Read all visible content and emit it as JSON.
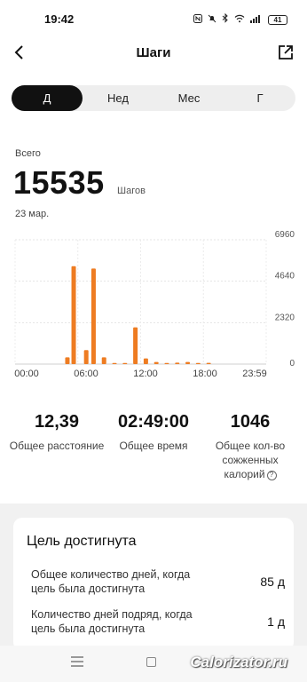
{
  "status_bar": {
    "time": "19:42",
    "battery": "41",
    "icons": [
      "nfc-icon",
      "mute-icon",
      "bluetooth-icon",
      "wifi-icon",
      "signal-icon"
    ]
  },
  "header": {
    "title": "Шаги",
    "back_icon": "chevron-left-icon",
    "share_icon": "share-icon"
  },
  "tabs": [
    {
      "label": "Д",
      "active": true
    },
    {
      "label": "Нед",
      "active": false
    },
    {
      "label": "Мес",
      "active": false
    },
    {
      "label": "Г",
      "active": false
    }
  ],
  "summary": {
    "total_label": "Всего",
    "total_value": "15535",
    "unit": "Шагов",
    "date": "23 мар."
  },
  "chart_data": {
    "type": "bar",
    "x_tick_labels": [
      "00:00",
      "06:00",
      "12:00",
      "18:00",
      "23:59"
    ],
    "y_tick_labels": [
      "6960",
      "4640",
      "2320",
      "0"
    ],
    "ylim": [
      0,
      6960
    ],
    "bar_color": "#ee7c22",
    "x_unit": "hour",
    "bars": [
      {
        "x": 5.0,
        "y": 380
      },
      {
        "x": 5.6,
        "y": 5480
      },
      {
        "x": 6.8,
        "y": 780
      },
      {
        "x": 7.5,
        "y": 5350
      },
      {
        "x": 8.5,
        "y": 380
      },
      {
        "x": 9.5,
        "y": 60
      },
      {
        "x": 10.5,
        "y": 60
      },
      {
        "x": 11.5,
        "y": 2060
      },
      {
        "x": 12.5,
        "y": 320
      },
      {
        "x": 13.5,
        "y": 120
      },
      {
        "x": 14.5,
        "y": 60
      },
      {
        "x": 15.5,
        "y": 80
      },
      {
        "x": 16.5,
        "y": 120
      },
      {
        "x": 17.5,
        "y": 60
      },
      {
        "x": 18.5,
        "y": 70
      }
    ]
  },
  "stats": [
    {
      "value": "12,39",
      "label": "Общее расстояние"
    },
    {
      "value": "02:49:00",
      "label": "Общее время"
    },
    {
      "value": "1046",
      "label_line1": "Общее кол-во",
      "label_line2": "сожженных",
      "label_line3": "калорий",
      "help_icon": "?"
    }
  ],
  "goal": {
    "title": "Цель достигнута",
    "rows": [
      {
        "label_line1": "Общее количество дней, когда",
        "label_line2": "цель была достигнута",
        "value": "85 д"
      },
      {
        "label_line1": "Количество дней подряд, когда",
        "label_line2": "цель была достигнута",
        "value": "1 д"
      }
    ]
  },
  "watermark": "Calorizator.ru"
}
